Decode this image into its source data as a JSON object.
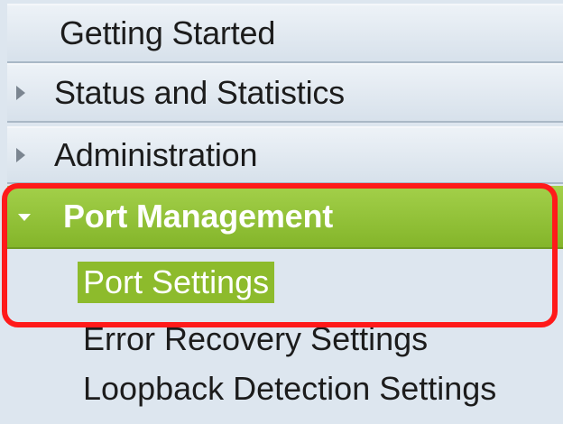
{
  "nav": {
    "getting_started": "Getting Started",
    "status_and_statistics": "Status and Statistics",
    "administration": "Administration",
    "port_management": "Port Management",
    "port_settings": "Port Settings",
    "error_recovery_settings": "Error Recovery Settings",
    "loopback_detection_settings": "Loopback Detection Settings"
  },
  "colors": {
    "selected_green": "#8dbb2c",
    "callout_red": "#ff1a1a",
    "panel_blue": "#dde6ef"
  },
  "icons": {
    "collapsed": "triangle-right",
    "expanded": "triangle-down"
  }
}
